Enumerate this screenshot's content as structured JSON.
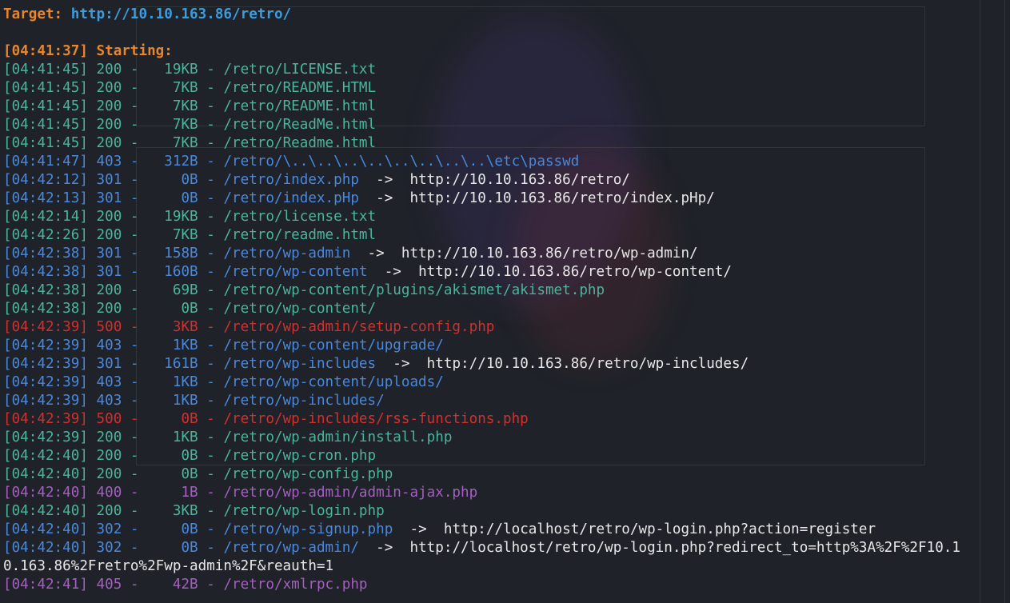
{
  "target": {
    "label": "Target:",
    "url": "http://10.10.163.86/retro/"
  },
  "starting": "[04:41:37] Starting:",
  "entries": [
    {
      "time": "[04:41:45]",
      "status": "200",
      "size": "19KB",
      "path": "/retro/LICENSE.txt",
      "redirect": ""
    },
    {
      "time": "[04:41:45]",
      "status": "200",
      "size": "7KB",
      "path": "/retro/README.HTML",
      "redirect": ""
    },
    {
      "time": "[04:41:45]",
      "status": "200",
      "size": "7KB",
      "path": "/retro/README.html",
      "redirect": ""
    },
    {
      "time": "[04:41:45]",
      "status": "200",
      "size": "7KB",
      "path": "/retro/ReadMe.html",
      "redirect": ""
    },
    {
      "time": "[04:41:45]",
      "status": "200",
      "size": "7KB",
      "path": "/retro/Readme.html",
      "redirect": ""
    },
    {
      "time": "[04:41:47]",
      "status": "403",
      "size": "312B",
      "path": "/retro/\\..\\..\\..\\..\\..\\..\\..\\..\\etc\\passwd",
      "redirect": ""
    },
    {
      "time": "[04:42:12]",
      "status": "301",
      "size": "0B",
      "path": "/retro/index.php",
      "redirect": "http://10.10.163.86/retro/"
    },
    {
      "time": "[04:42:13]",
      "status": "301",
      "size": "0B",
      "path": "/retro/index.pHp",
      "redirect": "http://10.10.163.86/retro/index.pHp/"
    },
    {
      "time": "[04:42:14]",
      "status": "200",
      "size": "19KB",
      "path": "/retro/license.txt",
      "redirect": ""
    },
    {
      "time": "[04:42:26]",
      "status": "200",
      "size": "7KB",
      "path": "/retro/readme.html",
      "redirect": ""
    },
    {
      "time": "[04:42:38]",
      "status": "301",
      "size": "158B",
      "path": "/retro/wp-admin",
      "redirect": "http://10.10.163.86/retro/wp-admin/"
    },
    {
      "time": "[04:42:38]",
      "status": "301",
      "size": "160B",
      "path": "/retro/wp-content",
      "redirect": "http://10.10.163.86/retro/wp-content/"
    },
    {
      "time": "[04:42:38]",
      "status": "200",
      "size": "69B",
      "path": "/retro/wp-content/plugins/akismet/akismet.php",
      "redirect": ""
    },
    {
      "time": "[04:42:38]",
      "status": "200",
      "size": "0B",
      "path": "/retro/wp-content/",
      "redirect": ""
    },
    {
      "time": "[04:42:39]",
      "status": "500",
      "size": "3KB",
      "path": "/retro/wp-admin/setup-config.php",
      "redirect": ""
    },
    {
      "time": "[04:42:39]",
      "status": "403",
      "size": "1KB",
      "path": "/retro/wp-content/upgrade/",
      "redirect": ""
    },
    {
      "time": "[04:42:39]",
      "status": "301",
      "size": "161B",
      "path": "/retro/wp-includes",
      "redirect": "http://10.10.163.86/retro/wp-includes/"
    },
    {
      "time": "[04:42:39]",
      "status": "403",
      "size": "1KB",
      "path": "/retro/wp-content/uploads/",
      "redirect": ""
    },
    {
      "time": "[04:42:39]",
      "status": "403",
      "size": "1KB",
      "path": "/retro/wp-includes/",
      "redirect": ""
    },
    {
      "time": "[04:42:39]",
      "status": "500",
      "size": "0B",
      "path": "/retro/wp-includes/rss-functions.php",
      "redirect": ""
    },
    {
      "time": "[04:42:39]",
      "status": "200",
      "size": "1KB",
      "path": "/retro/wp-admin/install.php",
      "redirect": ""
    },
    {
      "time": "[04:42:40]",
      "status": "200",
      "size": "0B",
      "path": "/retro/wp-cron.php",
      "redirect": ""
    },
    {
      "time": "[04:42:40]",
      "status": "200",
      "size": "0B",
      "path": "/retro/wp-config.php",
      "redirect": ""
    },
    {
      "time": "[04:42:40]",
      "status": "400",
      "size": "1B",
      "path": "/retro/wp-admin/admin-ajax.php",
      "redirect": ""
    },
    {
      "time": "[04:42:40]",
      "status": "200",
      "size": "3KB",
      "path": "/retro/wp-login.php",
      "redirect": ""
    },
    {
      "time": "[04:42:40]",
      "status": "302",
      "size": "0B",
      "path": "/retro/wp-signup.php",
      "redirect": "http://localhost/retro/wp-login.php?action=register"
    },
    {
      "time": "[04:42:40]",
      "status": "302",
      "size": "0B",
      "path": "/retro/wp-admin/",
      "redirect": "http://localhost/retro/wp-login.php?redirect_to=http%3A%2F%2F10.1"
    },
    {
      "time": "",
      "status": "wrap",
      "size": "",
      "path": "0.163.86%2Fretro%2Fwp-admin%2F&reauth=1",
      "redirect": ""
    },
    {
      "time": "[04:42:41]",
      "status": "405",
      "size": "42B",
      "path": "/retro/xmlrpc.php",
      "redirect": ""
    }
  ],
  "colors": {
    "ok": "#4cb49a",
    "redirect": "#4a88db",
    "error": "#d1302d",
    "client_error": "#a45fc0",
    "header": "#e6862f",
    "url": "#3e9cdb"
  }
}
